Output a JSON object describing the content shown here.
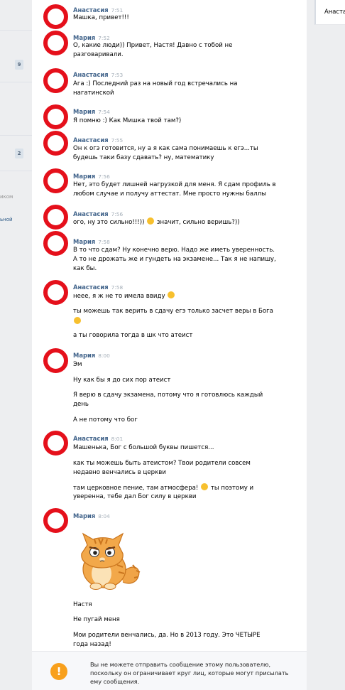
{
  "sidebar_fragments": {
    "badge_1": "9",
    "badge_2": "2",
    "frag_1": "иком",
    "frag_2": "ьной"
  },
  "right_panel": {
    "contact_name": "Анастасия"
  },
  "messages": [
    {
      "author": "Анастасия",
      "time": "7:51",
      "lines": [
        "Машка, привет!!!"
      ]
    },
    {
      "author": "Мария",
      "time": "7:52",
      "lines": [
        "О, какие люди)) Привет, Настя! Давно с тобой не",
        "разговаривали."
      ]
    },
    {
      "author": "Анастасия",
      "time": "7:53",
      "lines": [
        "Ага :) Последний раз на новый год встречались на",
        "нагатинской"
      ]
    },
    {
      "author": "Мария",
      "time": "7:54",
      "lines": [
        "Я помню :) Как Мишка твой там?)"
      ]
    },
    {
      "author": "Анастасия",
      "time": "7:55",
      "lines": [
        "Он к огэ готовится, ну а я как сама понимаешь к егэ...ты",
        "будешь таки базу сдавать? ну, математику"
      ]
    },
    {
      "author": "Мария",
      "time": "7:56",
      "lines": [
        "Нет, это будет лишней нагрузкой для меня. Я сдам профиль в",
        "любом случае и получу аттестат. Мне просто нужны баллы"
      ]
    },
    {
      "author": "Анастасия",
      "time": "7:56",
      "lines": [
        "ого, ну это сильно!!!)) ",
        " значит, сильно веришь?))"
      ]
    },
    {
      "author": "Мария",
      "time": "7:58",
      "lines": [
        "В то что сдам? Ну конечно верю. Надо же иметь уверенность.",
        "А то не дрожать же и гундеть на экзамене... Так я не напишу,",
        "как бы."
      ]
    },
    {
      "author": "Анастасия",
      "time": "7:58",
      "lines": [
        "неее, я ж не то имела ввиду ",
        "ты можешь так верить в сдачу егэ только засчет веры в Бога",
        "",
        "а ты говорила тогда в шк что атеист"
      ]
    },
    {
      "author": "Мария",
      "time": "8:00",
      "lines": [
        "Эм",
        "Ну как бы я до сих пор атеист",
        "Я верю в сдачу экзамена, потому что я готовлюсь каждый",
        "день",
        "А не потому что бог"
      ]
    },
    {
      "author": "Анастасия",
      "time": "8:01",
      "lines": [
        "Машенька, Бог с большой буквы пишется...",
        "как ты можешь быть атеистом? Твои родители совсем",
        "недавно венчались в церкви",
        "там церковное пение, там атмосфера! ",
        " ты поэтому и",
        "уверенна, тебе дал Бог силу в церкви"
      ]
    },
    {
      "author": "Мария",
      "time": "8:04",
      "lines": [
        "Настя",
        "Не пугай меня",
        "Мои родители венчались, да. Но в 2013 году. Это ЧЕТЫРЕ",
        "года назад!"
      ]
    }
  ],
  "notice": {
    "icon": "!",
    "text_1": "Вы не можете отправить сообщение этому пользователю,",
    "text_2": "поскольку он ограничивает круг лиц, которые могут присылать",
    "text_3": "ему сообщения."
  },
  "colors": {
    "avatar_ring": "#e5101b",
    "author": "#42648b",
    "notice_icon": "#f8a01c"
  }
}
